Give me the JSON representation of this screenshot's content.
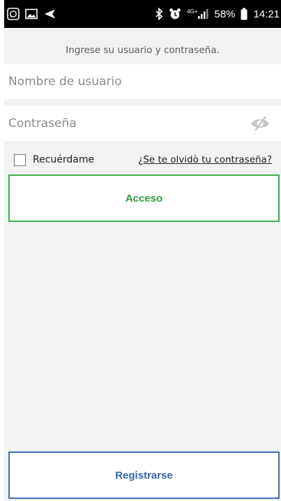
{
  "status_bar": {
    "battery_percent": "58%",
    "time": "14:21",
    "network": "4G+",
    "icons": [
      "whatsapp-icon",
      "gallery-icon",
      "send-icon",
      "bluetooth-icon",
      "alarm-icon",
      "signal-icon",
      "battery-icon"
    ]
  },
  "login": {
    "prompt": "Ingrese su usuario y contraseña.",
    "username_placeholder": "Nombre de usuario",
    "password_placeholder": "Contraseña",
    "remember_label": "Recuérdame",
    "forgot_link": "¿Se te olvidò tu contraseña?",
    "login_button": "Acceso",
    "register_button": "Registrarse"
  },
  "colors": {
    "login_accent": "#3fae49",
    "register_accent": "#3a6fb5",
    "background": "#f2f2f2"
  }
}
